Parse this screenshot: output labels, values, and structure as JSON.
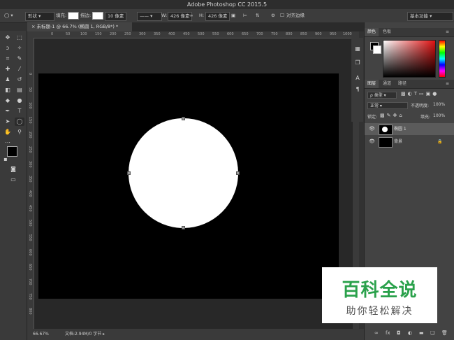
{
  "app": {
    "title": "Adobe Photoshop CC 2015.5"
  },
  "options_bar": {
    "mode": "形状",
    "fill_label": "填充:",
    "stroke_label": "描边:",
    "stroke_width": "10 像素",
    "w_label": "W:",
    "w_value": "426 像素",
    "h_label": "H:",
    "h_value": "426 像素",
    "align_edges": "对齐边缘",
    "workspace": "基本功能"
  },
  "document": {
    "tab_title": "未标题-1 @ 66.7% (椭圆 1, RGB/8*) *",
    "zoom": "66.67%",
    "doc_info": "文档:2.94M/0 字节"
  },
  "ruler": {
    "h": [
      "0",
      "50",
      "100",
      "150",
      "200",
      "250",
      "300",
      "350",
      "400",
      "450",
      "500",
      "550",
      "600",
      "650",
      "700",
      "750",
      "800",
      "850",
      "900",
      "950",
      "1000"
    ],
    "v": [
      "0",
      "50",
      "100",
      "150",
      "200",
      "250",
      "300",
      "350",
      "400",
      "450",
      "500",
      "550",
      "600",
      "650",
      "700",
      "750",
      "800"
    ]
  },
  "color_panel": {
    "tab_color": "颜色",
    "tab_swatches": "色板"
  },
  "layers_panel": {
    "tabs": [
      "图层",
      "通道",
      "路径"
    ],
    "kind_filter": "ρ 类型",
    "blend_mode": "正常",
    "opacity_label": "不透明度:",
    "opacity_value": "100%",
    "lock_label": "锁定:",
    "fill_label": "填充:",
    "fill_value": "100%",
    "layers": [
      {
        "name": "椭圆 1",
        "selected": true
      },
      {
        "name": "背景",
        "selected": false
      }
    ]
  },
  "watermark": {
    "title": "百科全说",
    "subtitle": "助你轻松解决"
  }
}
